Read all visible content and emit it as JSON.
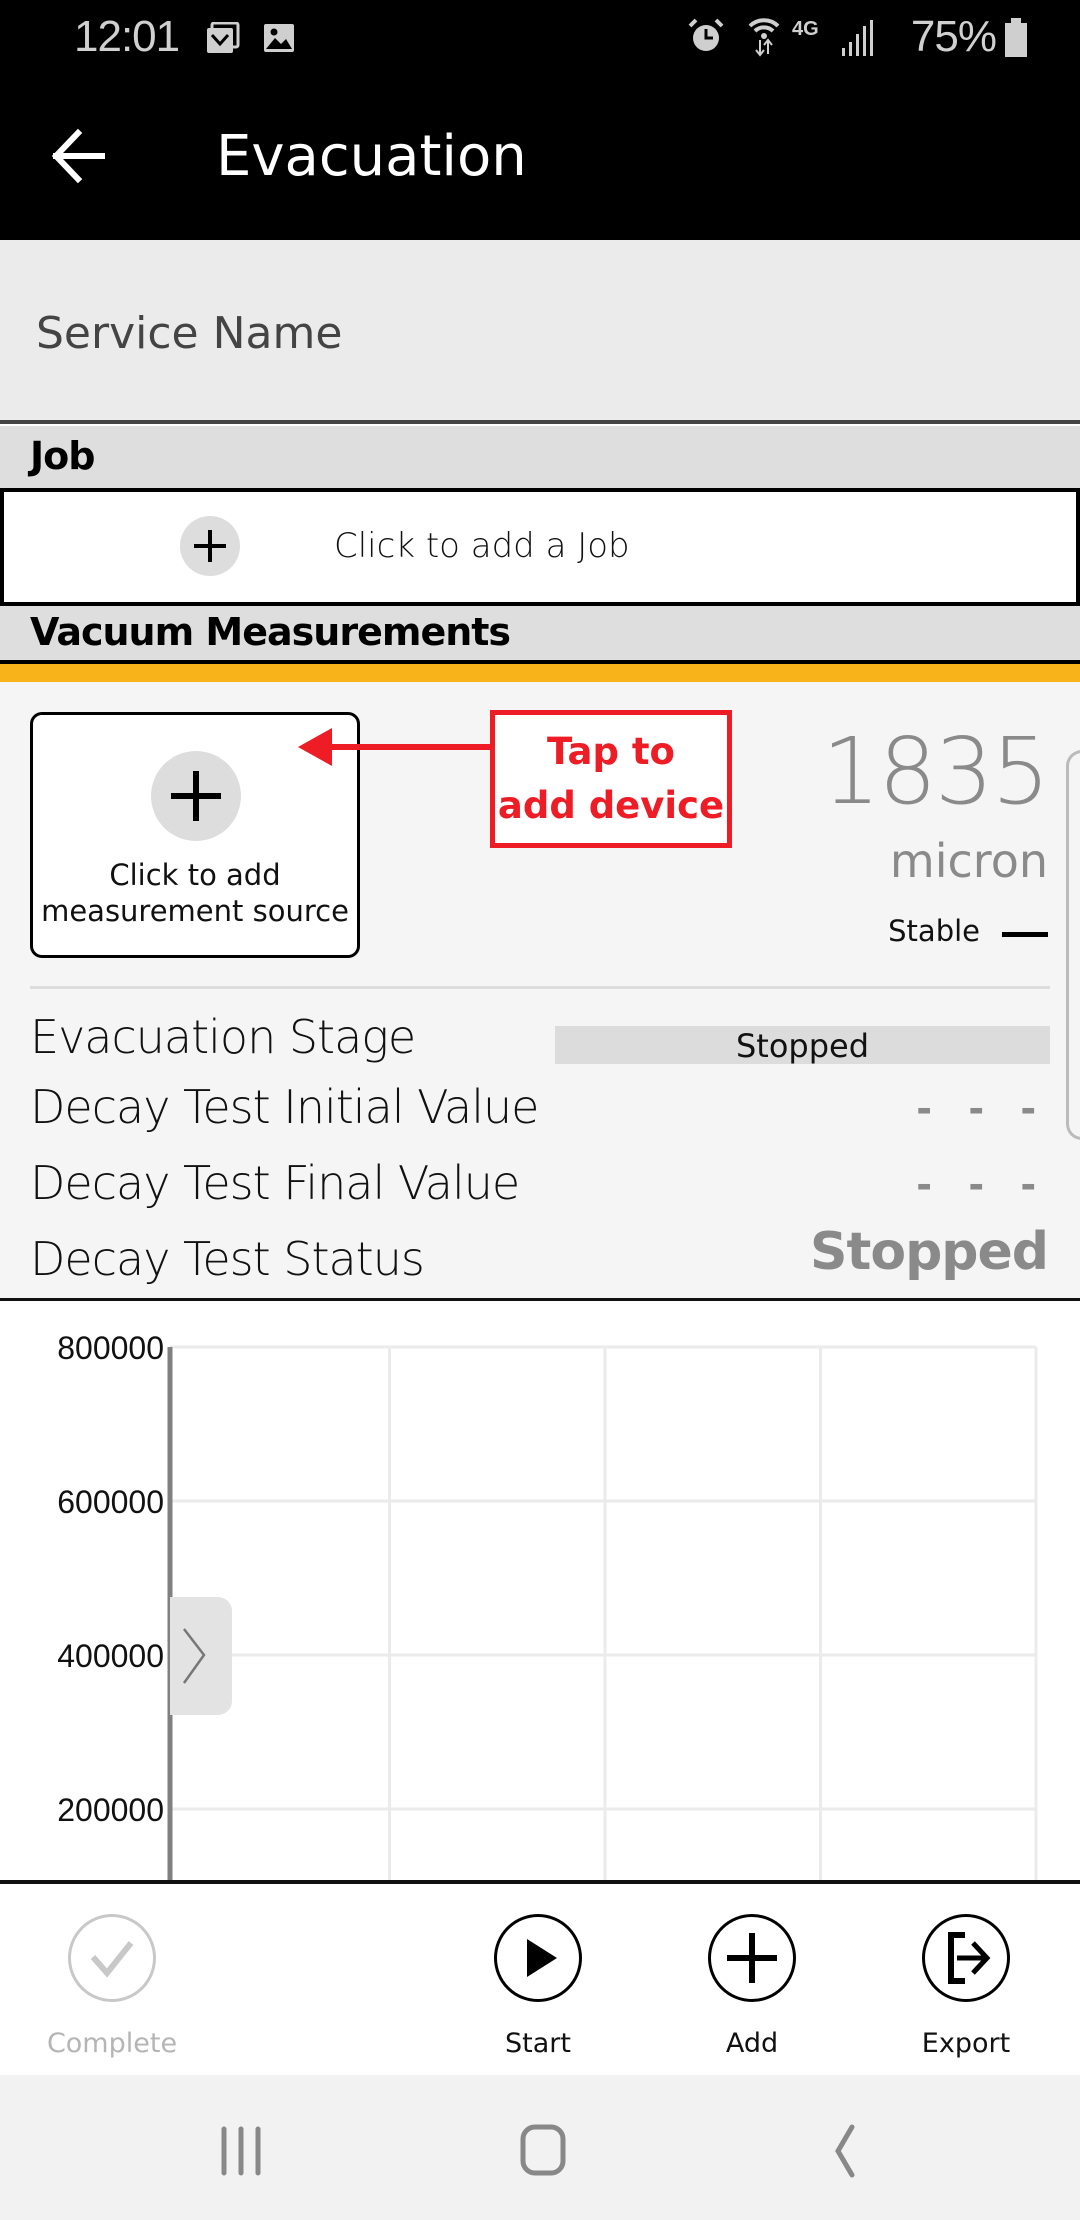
{
  "status_bar": {
    "time": "12:01",
    "left_icons": [
      "email-notification-icon",
      "image-notification-icon"
    ],
    "right_icons": [
      "alarm-icon",
      "wifi-icon",
      "4g-lte-icon",
      "signal-icon"
    ],
    "battery_percent": "75%"
  },
  "app_bar": {
    "back_icon": "arrow-left-icon",
    "title": "Evacuation"
  },
  "service_name": {
    "placeholder": "Service Name"
  },
  "job_section": {
    "header": "Job",
    "add_label": "Click to add a Job",
    "add_icon": "plus-icon"
  },
  "vacuum_section": {
    "header": "Vacuum Measurements",
    "accent_color": "#f9b31a",
    "add_source": {
      "label_line1": "Click to add",
      "label_line2": "measurement source",
      "icon": "plus-icon"
    },
    "callout": {
      "line1": "Tap to",
      "line2": "add device",
      "color": "#ee1c24"
    },
    "reading": {
      "value": "1835",
      "unit": "micron",
      "stability": "Stable"
    },
    "rows": [
      {
        "label": "Evacuation Stage",
        "value": "Stopped"
      },
      {
        "label": "Decay Test Initial Value",
        "value": "- - -"
      },
      {
        "label": "Decay Test Final Value",
        "value": "- - -"
      },
      {
        "label": "Decay Test Status",
        "value": "Stopped"
      }
    ]
  },
  "chart_data": {
    "type": "line",
    "title": "",
    "xlabel": "",
    "ylabel": "",
    "y_ticks": [
      800000,
      600000,
      400000,
      200000
    ],
    "ylim": [
      0,
      800000
    ],
    "x_gridlines": 4,
    "grid": true,
    "series": [],
    "expand_icon": "chevron-right-icon"
  },
  "action_bar": {
    "items": [
      {
        "id": "complete",
        "label": "Complete",
        "icon": "checkmark-circle-icon",
        "enabled": false
      },
      {
        "id": "start",
        "label": "Start",
        "icon": "play-circle-icon",
        "enabled": true
      },
      {
        "id": "add",
        "label": "Add",
        "icon": "plus-circle-icon",
        "enabled": true
      },
      {
        "id": "export",
        "label": "Export",
        "icon": "export-icon",
        "enabled": true
      }
    ]
  },
  "nav_bar": {
    "items": [
      "recents-icon",
      "home-icon",
      "back-icon"
    ]
  }
}
